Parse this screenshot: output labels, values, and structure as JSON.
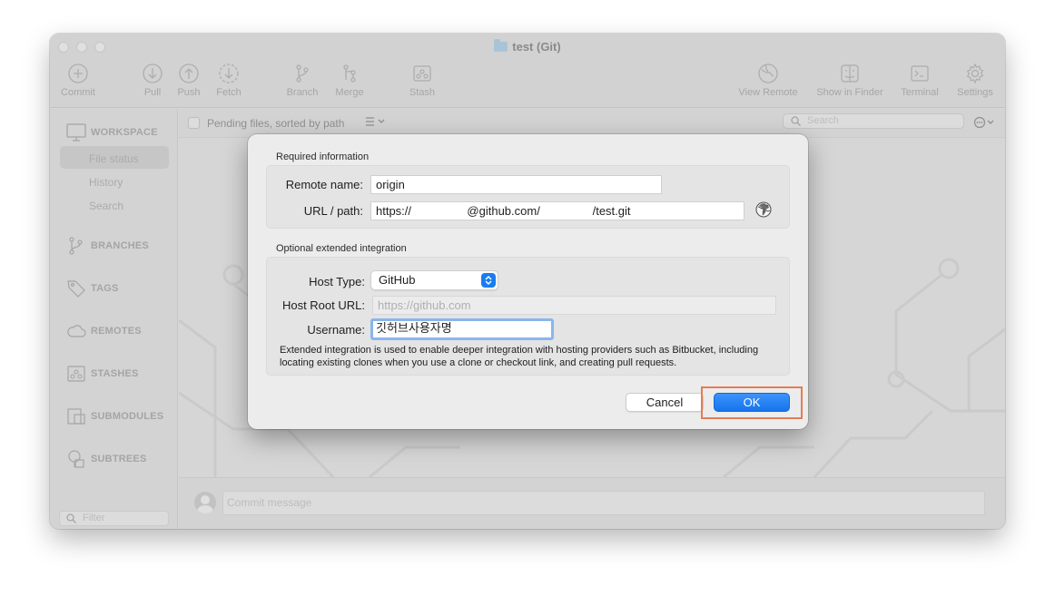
{
  "window": {
    "title": "test (Git)"
  },
  "toolbar": {
    "items": [
      {
        "label": "Commit",
        "icon": "commit-icon"
      },
      {
        "label": "Pull",
        "icon": "pull-icon"
      },
      {
        "label": "Push",
        "icon": "push-icon"
      },
      {
        "label": "Fetch",
        "icon": "fetch-icon"
      },
      {
        "label": "Branch",
        "icon": "branch-icon"
      },
      {
        "label": "Merge",
        "icon": "merge-icon"
      },
      {
        "label": "Stash",
        "icon": "stash-icon"
      },
      {
        "label": "View Remote",
        "icon": "globe-icon"
      },
      {
        "label": "Show in Finder",
        "icon": "finder-icon"
      },
      {
        "label": "Terminal",
        "icon": "terminal-icon"
      },
      {
        "label": "Settings",
        "icon": "gear-icon"
      }
    ]
  },
  "sidebar": {
    "workspace": "WORKSPACE",
    "workspace_items": [
      "File status",
      "History",
      "Search"
    ],
    "selected": "File status",
    "branches": "BRANCHES",
    "tags": "TAGS",
    "remotes": "REMOTES",
    "stashes": "STASHES",
    "submodules": "SUBMODULES",
    "subtrees": "SUBTREES",
    "filter_placeholder": "Filter"
  },
  "main": {
    "pending_label": "Pending files, sorted by path",
    "search_placeholder": "Search",
    "commit_placeholder": "Commit message"
  },
  "dialog": {
    "required_title": "Required information",
    "remote_name_label": "Remote name:",
    "remote_name_value": "origin",
    "url_label": "URL / path:",
    "url_value": "https://                 @github.com/                /test.git",
    "optional_title": "Optional extended integration",
    "host_type_label": "Host Type:",
    "host_type_value": "GitHub",
    "host_root_label": "Host Root URL:",
    "host_root_placeholder": "https://github.com",
    "username_label": "Username:",
    "username_value": "깃허브사용자명",
    "description": "Extended integration is used to enable deeper integration with hosting providers such as Bitbucket, including locating existing clones when you use a clone or checkout link, and creating pull requests.",
    "cancel_label": "Cancel",
    "ok_label": "OK"
  },
  "colors": {
    "accent": "#1a7cf0",
    "highlight": "#e47d53",
    "focus_ring": "#8ab5ee"
  }
}
